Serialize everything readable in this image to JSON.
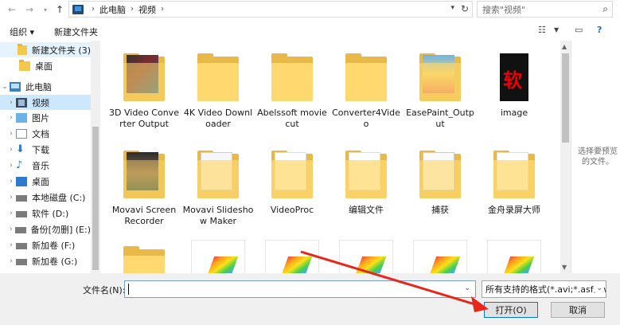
{
  "address_bar": {
    "crumbs": [
      "此电脑",
      "视频"
    ]
  },
  "search": {
    "placeholder": "搜索\"视频\""
  },
  "toolbar": {
    "organize": "组织 ▾",
    "new_folder": "新建文件夹"
  },
  "nav": {
    "items": [
      {
        "label": "新建文件夹 (3)",
        "icon": "folder-icon"
      },
      {
        "label": "桌面",
        "icon": "folder-icon"
      },
      {
        "label": "此电脑",
        "icon": "pc-icon"
      },
      {
        "label": "视频",
        "icon": "video-icon"
      },
      {
        "label": "图片",
        "icon": "pictures-icon"
      },
      {
        "label": "文档",
        "icon": "documents-icon"
      },
      {
        "label": "下载",
        "icon": "download-icon"
      },
      {
        "label": "音乐",
        "icon": "music-icon"
      },
      {
        "label": "桌面",
        "icon": "desktop-icon"
      },
      {
        "label": "本地磁盘 (C:)",
        "icon": "drive-icon"
      },
      {
        "label": "软件 (D:)",
        "icon": "drive-icon"
      },
      {
        "label": "备份[勿删] (E:)",
        "icon": "drive-icon"
      },
      {
        "label": "新加卷 (F:)",
        "icon": "drive-icon"
      },
      {
        "label": "新加卷 (G:)",
        "icon": "drive-icon"
      }
    ]
  },
  "files": {
    "row1": [
      "3D Video Converter Output",
      "4K Video Downloader",
      "Abelssoft moviecut",
      "Converter4Video",
      "EasePaint_Output",
      "image"
    ],
    "row2": [
      "Movavi Screen Recorder",
      "Movavi Slideshow Maker",
      "VideoProc",
      "编辑文件",
      "捕获",
      "金舟录屏大师"
    ]
  },
  "preview": {
    "message": "选择要预览的文件。"
  },
  "bottom": {
    "filename_label": "文件名(N):",
    "filename_value": "",
    "filetype": "所有支持的格式(*.avi;*.asf;*.wr",
    "open_label": "打开(O)",
    "cancel_label": "取消"
  },
  "colors": {
    "selection": "#cce8ff",
    "folder": "#ffd970",
    "accent": "#0078d7",
    "annotation": "#e8271a"
  }
}
